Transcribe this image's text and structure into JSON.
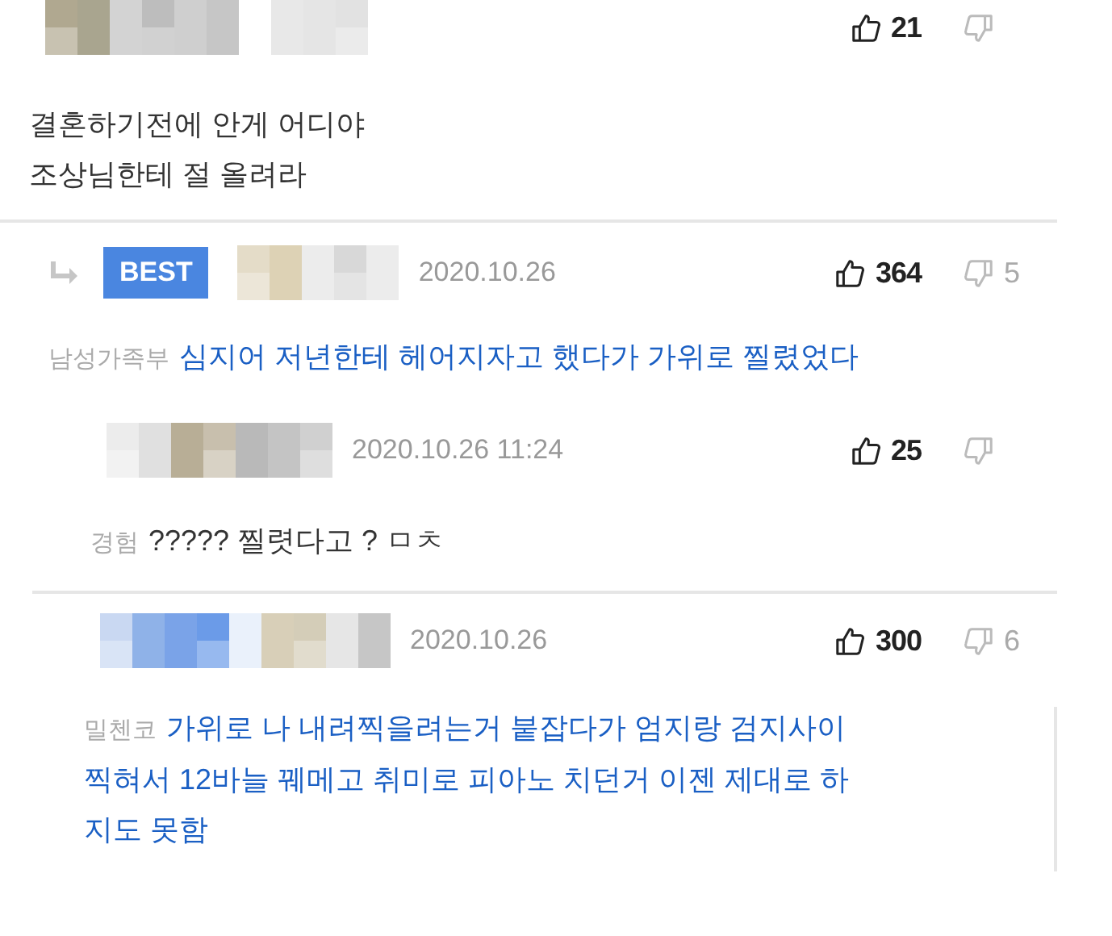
{
  "comments": [
    {
      "best": false,
      "reply": false,
      "likes": "21",
      "emphasized": false,
      "lines": [
        "결혼하기전에 안게 어디야",
        "조상님한테 절 올려라"
      ]
    },
    {
      "best": true,
      "reply": true,
      "badge": "BEST",
      "date": "2020.10.26",
      "likes": "364",
      "dislikes": "5",
      "tag": "남성가족부",
      "emphasized": true,
      "lines": [
        "심지어 저년한테 헤어지자고 했다가 가위로 찔렸었다"
      ]
    },
    {
      "best": false,
      "reply": false,
      "date": "2020.10.26 11:24",
      "likes": "25",
      "tag": "경험",
      "emphasized": false,
      "lines": [
        "????? 찔렷다고 ? ㅁㅊ"
      ]
    },
    {
      "best": false,
      "reply": false,
      "date": "2020.10.26",
      "likes": "300",
      "dislikes": "6",
      "tag": "밀첸코",
      "emphasized": true,
      "lines": [
        "가위로 나 내려찍을려는거 붙잡다가 엄지랑 검지사이",
        "찍혀서 12바늘 꿰메고 취미로 피아노 치던거 이젠 제대로 하",
        "지도 못함"
      ]
    }
  ]
}
